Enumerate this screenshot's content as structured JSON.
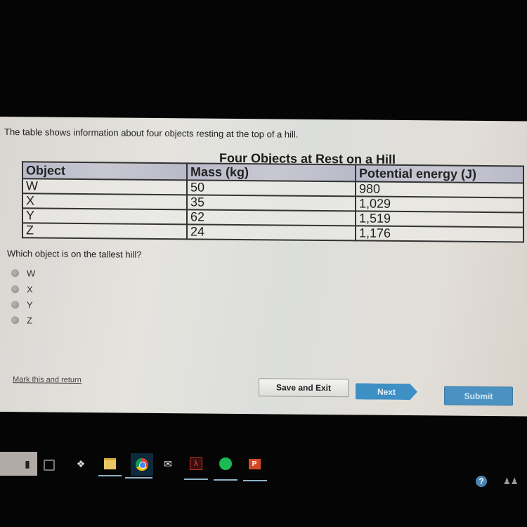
{
  "question": {
    "prompt": "The table shows information about four objects resting at the top of a hill.",
    "table_title": "Four Objects at Rest on a Hill",
    "columns": [
      "Object",
      "Mass (kg)",
      "Potential energy (J)"
    ],
    "rows": [
      [
        "W",
        "50",
        "980"
      ],
      [
        "X",
        "35",
        "1,029"
      ],
      [
        "Y",
        "62",
        "1,519"
      ],
      [
        "Z",
        "24",
        "1,176"
      ]
    ],
    "text": "Which object is on the tallest hill?",
    "options": [
      "W",
      "X",
      "Y",
      "Z"
    ]
  },
  "footer": {
    "mark_link": "Mark this and return",
    "save_exit": "Save and Exit",
    "next": "Next",
    "submit": "Submit"
  },
  "taskbar": {
    "icons": [
      "microphone-icon",
      "task-view-icon",
      "dropbox-icon",
      "file-explorer-icon",
      "chrome-icon",
      "mail-icon",
      "acrobat-icon",
      "spotify-icon",
      "powerpoint-icon"
    ],
    "help_label": "?",
    "powerpoint_label": "P"
  }
}
